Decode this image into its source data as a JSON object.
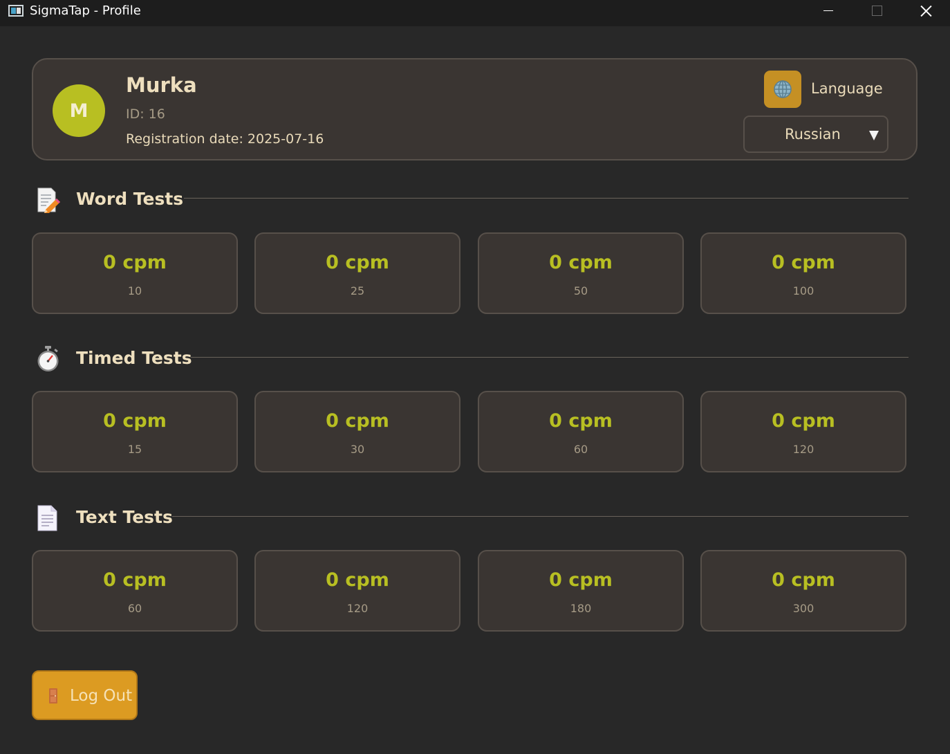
{
  "window": {
    "title": "SigmaTap - Profile"
  },
  "profile": {
    "avatar_letter": "M",
    "name": "Murka",
    "id_text": "ID: 16",
    "registration_text": "Registration date: 2025-07-16",
    "language_label": "Language",
    "language_value": "Russian"
  },
  "sections": {
    "word": {
      "title": "Word Tests",
      "icon": "memo-pencil-icon",
      "cards": [
        {
          "value": "0 cpm",
          "label": "10"
        },
        {
          "value": "0 cpm",
          "label": "25"
        },
        {
          "value": "0 cpm",
          "label": "50"
        },
        {
          "value": "0 cpm",
          "label": "100"
        }
      ]
    },
    "timed": {
      "title": "Timed Tests",
      "icon": "stopwatch-icon",
      "cards": [
        {
          "value": "0 cpm",
          "label": "15"
        },
        {
          "value": "0 cpm",
          "label": "30"
        },
        {
          "value": "0 cpm",
          "label": "60"
        },
        {
          "value": "0 cpm",
          "label": "120"
        }
      ]
    },
    "text": {
      "title": "Text Tests",
      "icon": "document-icon",
      "cards": [
        {
          "value": "0 cpm",
          "label": "60"
        },
        {
          "value": "0 cpm",
          "label": "120"
        },
        {
          "value": "0 cpm",
          "label": "180"
        },
        {
          "value": "0 cpm",
          "label": "300"
        }
      ]
    }
  },
  "logout": {
    "label": "Log Out",
    "icon": "door-icon"
  },
  "colors": {
    "background": "#282828",
    "card": "#3a3532",
    "accent": "#b8bf22",
    "button": "#dc9b22"
  }
}
